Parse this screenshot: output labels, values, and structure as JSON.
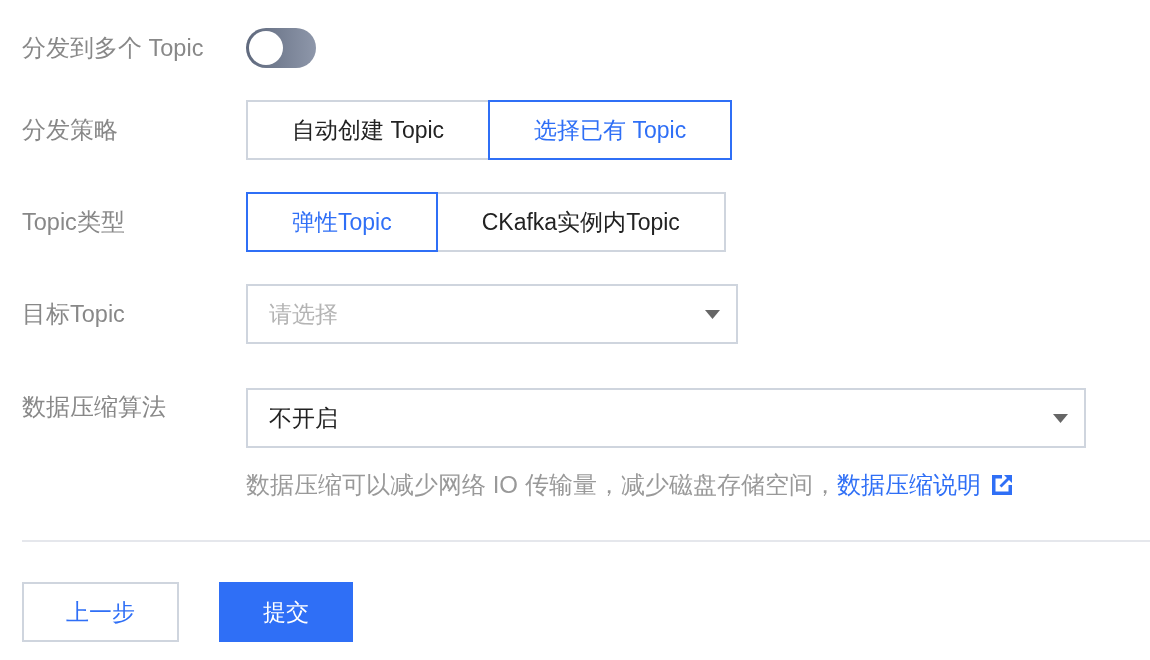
{
  "fields": [
    {
      "kind": "toggle",
      "label": "分发到多个 Topic",
      "on": false
    },
    {
      "kind": "segmented",
      "label": "分发策略",
      "options": [
        {
          "label": "自动创建 Topic",
          "selected": false
        },
        {
          "label": "选择已有 Topic",
          "selected": true
        }
      ]
    },
    {
      "kind": "segmented",
      "label": "Topic类型",
      "options": [
        {
          "label": "弹性Topic",
          "selected": true
        },
        {
          "label": "CKafka实例内Topic",
          "selected": false
        }
      ]
    },
    {
      "kind": "select",
      "label": "目标Topic",
      "wide": false,
      "placeholder": "请选择"
    },
    {
      "kind": "select",
      "label": "数据压缩算法",
      "wide": true,
      "value": "不开启",
      "help": {
        "text": "数据压缩可以减少网络 IO 传输量，减少磁盘存储空间，",
        "link": "数据压缩说明"
      }
    }
  ],
  "buttons": [
    {
      "label": "上一步",
      "kind": "secondary"
    },
    {
      "label": "提交",
      "kind": "primary"
    }
  ]
}
